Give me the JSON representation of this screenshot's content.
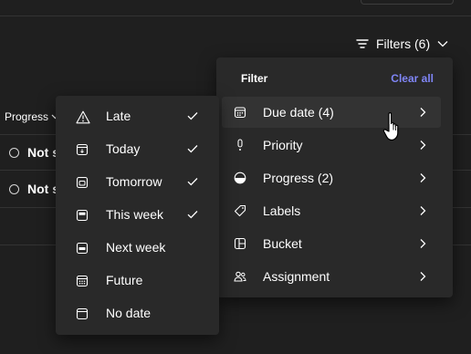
{
  "toolbar": {
    "filters_label": "Filters (6)"
  },
  "table": {
    "progress_header": "Progress",
    "rows": [
      {
        "status": "Not s"
      },
      {
        "status": "Not s"
      }
    ]
  },
  "filter_panel": {
    "title": "Filter",
    "clear_all": "Clear all",
    "items": [
      {
        "label": "Due date (4)",
        "icon": "calendar-icon"
      },
      {
        "label": "Priority",
        "icon": "priority-icon"
      },
      {
        "label": "Progress (2)",
        "icon": "progress-icon"
      },
      {
        "label": "Labels",
        "icon": "tag-icon"
      },
      {
        "label": "Bucket",
        "icon": "bucket-icon"
      },
      {
        "label": "Assignment",
        "icon": "people-icon"
      }
    ]
  },
  "due_date_menu": {
    "items": [
      {
        "label": "Late",
        "checked": true,
        "icon": "warning-icon"
      },
      {
        "label": "Today",
        "checked": true,
        "icon": "calendar-today-icon"
      },
      {
        "label": "Tomorrow",
        "checked": true,
        "icon": "calendar-tomorrow-icon"
      },
      {
        "label": "This week",
        "checked": true,
        "icon": "calendar-week-icon"
      },
      {
        "label": "Next week",
        "checked": false,
        "icon": "calendar-next-week-icon"
      },
      {
        "label": "Future",
        "checked": false,
        "icon": "calendar-future-icon"
      },
      {
        "label": "No date",
        "checked": false,
        "icon": "calendar-empty-icon"
      }
    ]
  },
  "colors": {
    "background": "#1f1f1f",
    "panel": "#292929",
    "accent": "#7f85f5",
    "text": "#ffffff"
  }
}
